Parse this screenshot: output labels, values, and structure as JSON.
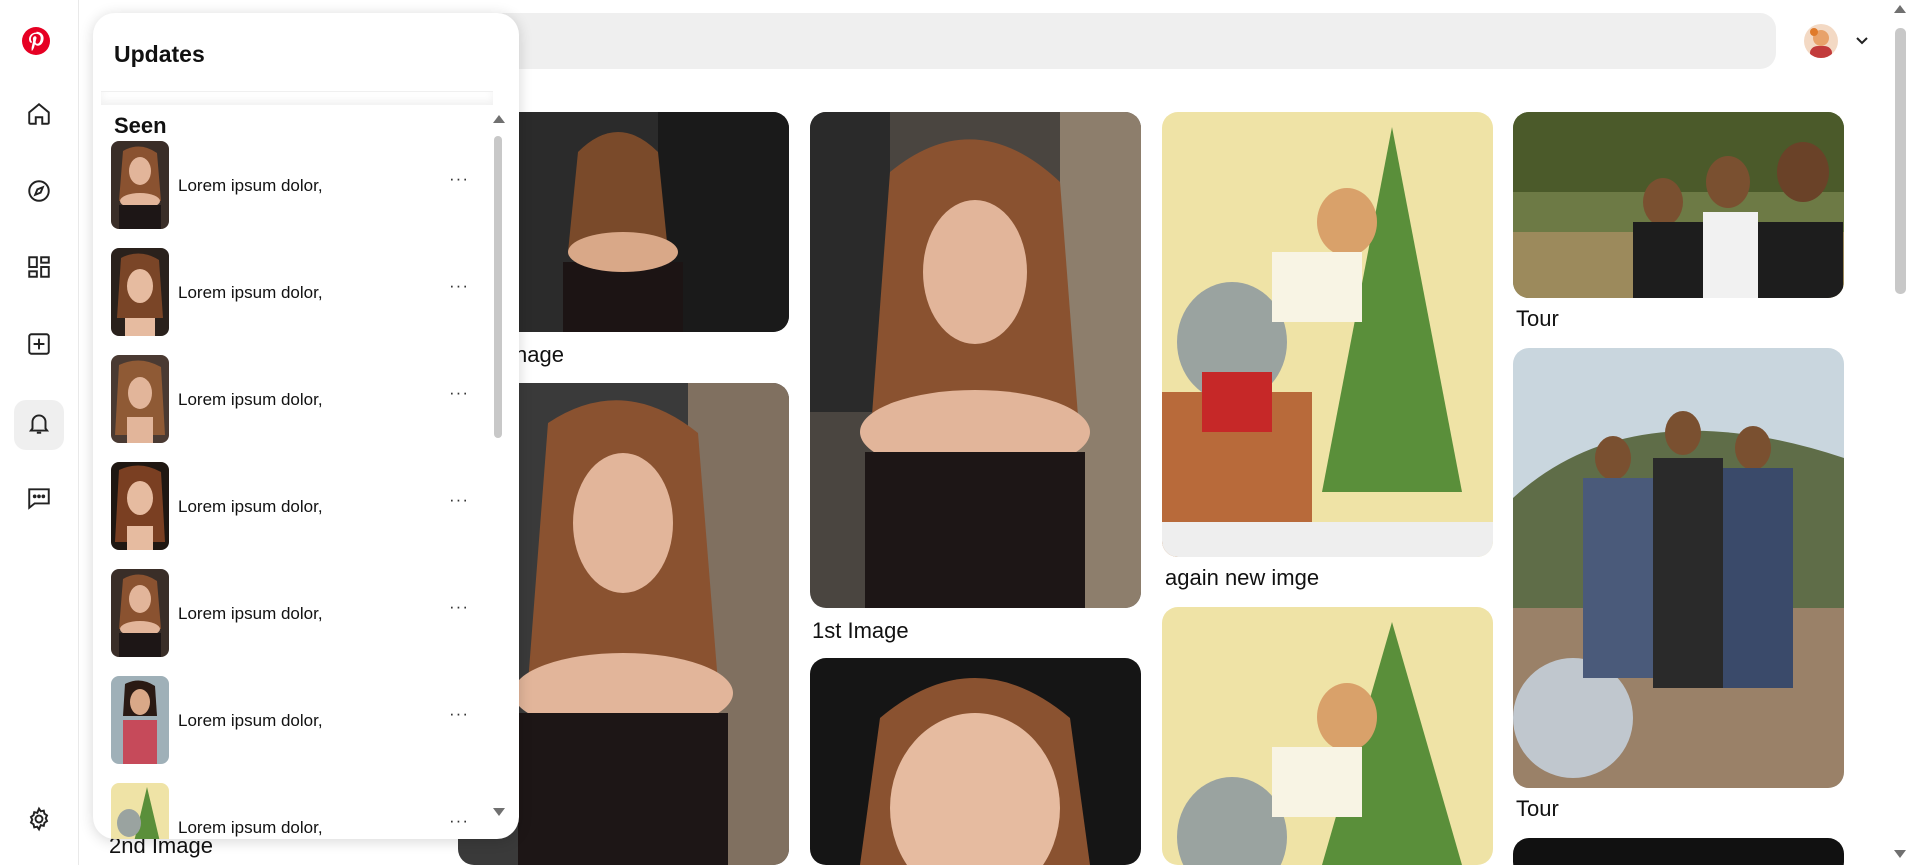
{
  "sidebar": {
    "items": [
      {
        "icon": "pinterest-logo-icon"
      },
      {
        "icon": "home-icon"
      },
      {
        "icon": "compass-icon"
      },
      {
        "icon": "dashboard-icon"
      },
      {
        "icon": "create-icon"
      },
      {
        "icon": "bell-icon",
        "active": true
      },
      {
        "icon": "messages-icon"
      },
      {
        "icon": "settings-icon"
      }
    ]
  },
  "header": {
    "search_placeholder": "",
    "account_icon": "chevron-down-icon"
  },
  "colors": {
    "brand": "#e60023",
    "active_bg": "#efefef",
    "search_bg": "#efefef"
  },
  "updates_panel": {
    "title": "Updates",
    "section": "Seen",
    "items": [
      {
        "text": "Lorem ipsum dolor,",
        "more": "···"
      },
      {
        "text": "Lorem ipsum dolor,",
        "more": "···"
      },
      {
        "text": "Lorem ipsum dolor,",
        "more": "···"
      },
      {
        "text": "Lorem ipsum dolor,",
        "more": "···"
      },
      {
        "text": "Lorem ipsum dolor,",
        "more": "···"
      },
      {
        "text": "Lorem ipsum dolor,",
        "more": "···"
      },
      {
        "text": "Lorem ipsum dolor,",
        "more": "···"
      }
    ]
  },
  "pins": {
    "col1_top_label": "nage",
    "col1_bottom_label": "2nd Image",
    "col2_label": "1st Image",
    "col3_label": "again new imge",
    "col4_top_label": "Tour",
    "col4_mid_label": "Tour"
  }
}
